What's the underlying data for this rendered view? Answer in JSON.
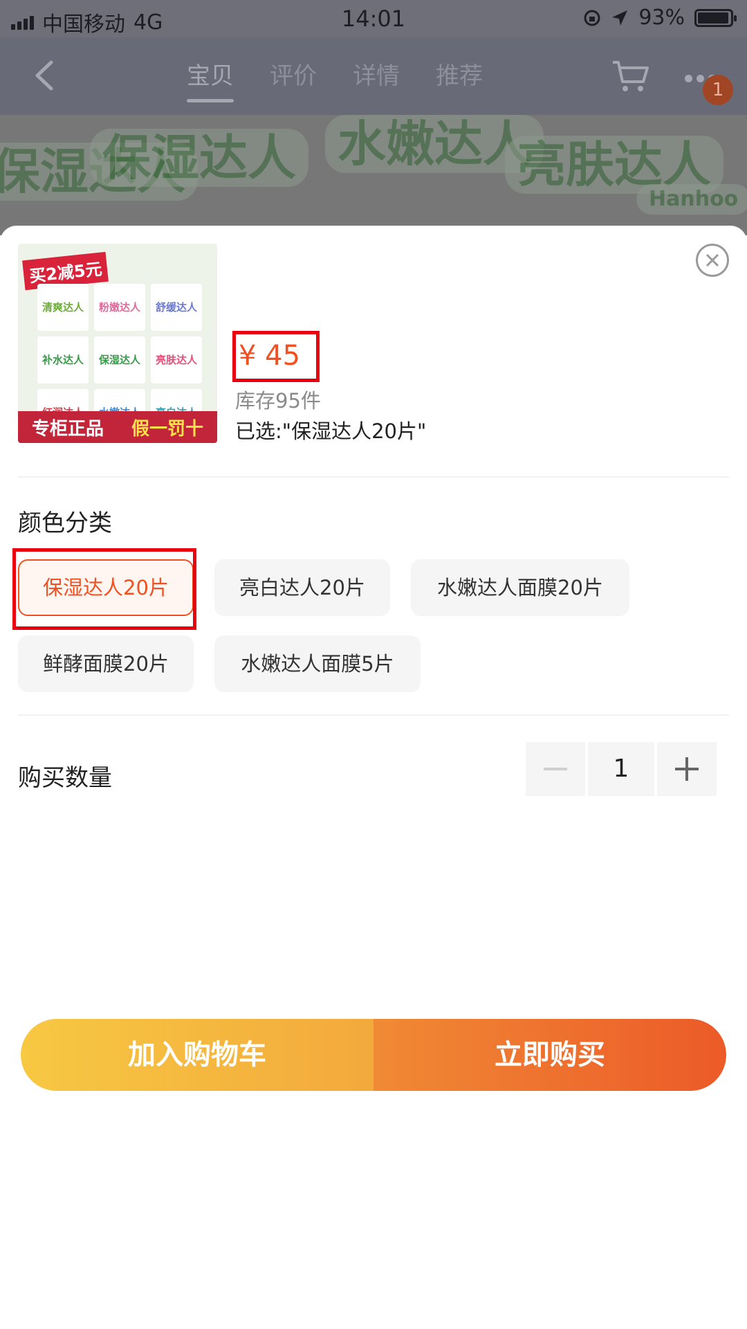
{
  "status_bar": {
    "carrier": "中国移动",
    "network": "4G",
    "time": "14:01",
    "battery": "93%"
  },
  "nav": {
    "tabs": [
      {
        "label": "宝贝",
        "active": true
      },
      {
        "label": "评价",
        "active": false
      },
      {
        "label": "详情",
        "active": false
      },
      {
        "label": "推荐",
        "active": false
      }
    ],
    "cart_badge": "1",
    "icons": [
      "back-chevron-icon",
      "cart-icon",
      "more-dots-icon"
    ]
  },
  "hero": {
    "words": [
      "保湿达人",
      "水嫩达人",
      "亮肤达人",
      "Hanhoo"
    ]
  },
  "product": {
    "thumbnail": {
      "promo": "买2减5元",
      "cells": [
        "清爽达人",
        "粉嫩达人",
        "舒缓达人",
        "补水达人",
        "保湿达人",
        "亮肤达人",
        "红润达人",
        "水嫩达人",
        "亮白达人"
      ],
      "banner_left": "专柜正品",
      "banner_right": "假一罚十"
    },
    "price": "¥ 45",
    "stock": "库存95件",
    "selected": "已选:\"保湿达人20片\""
  },
  "variants": {
    "title": "颜色分类",
    "options": [
      {
        "label": "保湿达人20片",
        "selected": true
      },
      {
        "label": "亮白达人20片",
        "selected": false
      },
      {
        "label": "水嫩达人面膜20片",
        "selected": false
      },
      {
        "label": "鲜酵面膜20片",
        "selected": false
      },
      {
        "label": "水嫩达人面膜5片",
        "selected": false
      }
    ]
  },
  "quantity": {
    "title": "购买数量",
    "value": "1"
  },
  "actions": {
    "add_to_cart": "加入购物车",
    "buy_now": "立即购买"
  },
  "colors": {
    "accent": "#f05123",
    "highlight": "#e8000e",
    "cart_gradient": [
      "#f7c842",
      "#f3a93c"
    ],
    "buy_gradient": [
      "#f08a35",
      "#ec5a28"
    ]
  }
}
